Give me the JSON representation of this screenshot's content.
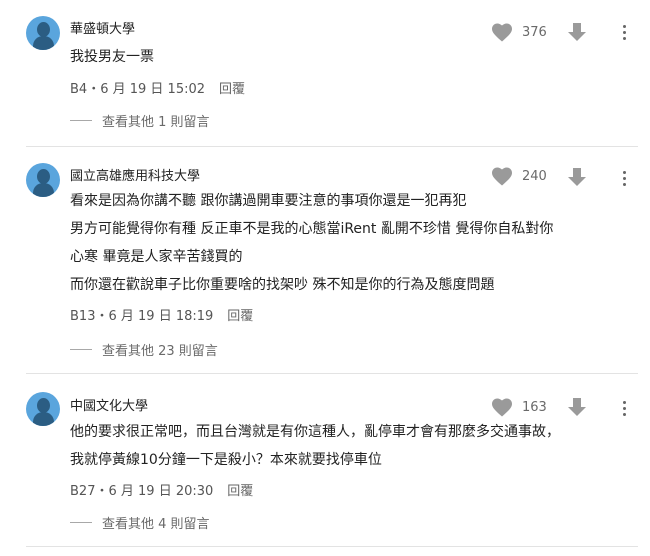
{
  "comments": [
    {
      "school": "華盛頓大學",
      "lines": [
        "我投男友一票"
      ],
      "floor": "B4",
      "date": "6 月 19 日 15:02",
      "reply_label": "回覆",
      "likes": "376",
      "more_replies": "查看其他 1 則留言"
    },
    {
      "school": "國立高雄應用科技大學",
      "lines": [
        "看來是因為你講不聽  跟你講過開車要注意的事項你還是一犯再犯",
        "男方可能覺得你有種  反正車不是我的心態當iRent 亂開不珍惜  覺得你自私對你",
        "心寒  畢竟是人家辛苦錢買的",
        "而你還在歡說車子比你重要啥的找架吵  殊不知是你的行為及態度問題"
      ],
      "floor": "B13",
      "date": "6 月 19 日 18:19",
      "reply_label": "回覆",
      "likes": "240",
      "more_replies": "查看其他 23 則留言"
    },
    {
      "school": "中國文化大學",
      "lines": [
        "他的要求很正常吧，而且台灣就是有你這種人，亂停車才會有那麼多交通事故，",
        "我就停黃線10分鐘一下是殺小？本來就要找停車位"
      ],
      "floor": "B27",
      "date": "6 月 19 日 20:30",
      "reply_label": "回覆",
      "likes": "163",
      "more_replies": "查看其他 4 則留言"
    }
  ],
  "colors": {
    "avatar_bg": "#5aa5dd",
    "avatar_figure": "#2b5d83",
    "icon_gray": "#9a9a9a",
    "text": "#222222",
    "muted": "#6a6a6a"
  },
  "icons": {
    "like": "heart-icon",
    "dislike": "down-arrow-icon",
    "menu": "more-vert-icon"
  }
}
